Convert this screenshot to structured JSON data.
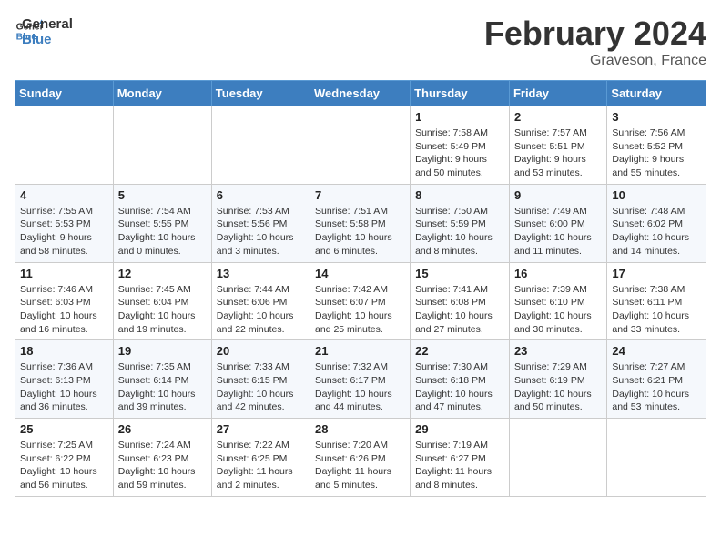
{
  "header": {
    "logo_line1": "General",
    "logo_line2": "Blue",
    "month": "February 2024",
    "location": "Graveson, France"
  },
  "weekdays": [
    "Sunday",
    "Monday",
    "Tuesday",
    "Wednesday",
    "Thursday",
    "Friday",
    "Saturday"
  ],
  "weeks": [
    [
      {
        "day": "",
        "info": ""
      },
      {
        "day": "",
        "info": ""
      },
      {
        "day": "",
        "info": ""
      },
      {
        "day": "",
        "info": ""
      },
      {
        "day": "1",
        "info": "Sunrise: 7:58 AM\nSunset: 5:49 PM\nDaylight: 9 hours\nand 50 minutes."
      },
      {
        "day": "2",
        "info": "Sunrise: 7:57 AM\nSunset: 5:51 PM\nDaylight: 9 hours\nand 53 minutes."
      },
      {
        "day": "3",
        "info": "Sunrise: 7:56 AM\nSunset: 5:52 PM\nDaylight: 9 hours\nand 55 minutes."
      }
    ],
    [
      {
        "day": "4",
        "info": "Sunrise: 7:55 AM\nSunset: 5:53 PM\nDaylight: 9 hours\nand 58 minutes."
      },
      {
        "day": "5",
        "info": "Sunrise: 7:54 AM\nSunset: 5:55 PM\nDaylight: 10 hours\nand 0 minutes."
      },
      {
        "day": "6",
        "info": "Sunrise: 7:53 AM\nSunset: 5:56 PM\nDaylight: 10 hours\nand 3 minutes."
      },
      {
        "day": "7",
        "info": "Sunrise: 7:51 AM\nSunset: 5:58 PM\nDaylight: 10 hours\nand 6 minutes."
      },
      {
        "day": "8",
        "info": "Sunrise: 7:50 AM\nSunset: 5:59 PM\nDaylight: 10 hours\nand 8 minutes."
      },
      {
        "day": "9",
        "info": "Sunrise: 7:49 AM\nSunset: 6:00 PM\nDaylight: 10 hours\nand 11 minutes."
      },
      {
        "day": "10",
        "info": "Sunrise: 7:48 AM\nSunset: 6:02 PM\nDaylight: 10 hours\nand 14 minutes."
      }
    ],
    [
      {
        "day": "11",
        "info": "Sunrise: 7:46 AM\nSunset: 6:03 PM\nDaylight: 10 hours\nand 16 minutes."
      },
      {
        "day": "12",
        "info": "Sunrise: 7:45 AM\nSunset: 6:04 PM\nDaylight: 10 hours\nand 19 minutes."
      },
      {
        "day": "13",
        "info": "Sunrise: 7:44 AM\nSunset: 6:06 PM\nDaylight: 10 hours\nand 22 minutes."
      },
      {
        "day": "14",
        "info": "Sunrise: 7:42 AM\nSunset: 6:07 PM\nDaylight: 10 hours\nand 25 minutes."
      },
      {
        "day": "15",
        "info": "Sunrise: 7:41 AM\nSunset: 6:08 PM\nDaylight: 10 hours\nand 27 minutes."
      },
      {
        "day": "16",
        "info": "Sunrise: 7:39 AM\nSunset: 6:10 PM\nDaylight: 10 hours\nand 30 minutes."
      },
      {
        "day": "17",
        "info": "Sunrise: 7:38 AM\nSunset: 6:11 PM\nDaylight: 10 hours\nand 33 minutes."
      }
    ],
    [
      {
        "day": "18",
        "info": "Sunrise: 7:36 AM\nSunset: 6:13 PM\nDaylight: 10 hours\nand 36 minutes."
      },
      {
        "day": "19",
        "info": "Sunrise: 7:35 AM\nSunset: 6:14 PM\nDaylight: 10 hours\nand 39 minutes."
      },
      {
        "day": "20",
        "info": "Sunrise: 7:33 AM\nSunset: 6:15 PM\nDaylight: 10 hours\nand 42 minutes."
      },
      {
        "day": "21",
        "info": "Sunrise: 7:32 AM\nSunset: 6:17 PM\nDaylight: 10 hours\nand 44 minutes."
      },
      {
        "day": "22",
        "info": "Sunrise: 7:30 AM\nSunset: 6:18 PM\nDaylight: 10 hours\nand 47 minutes."
      },
      {
        "day": "23",
        "info": "Sunrise: 7:29 AM\nSunset: 6:19 PM\nDaylight: 10 hours\nand 50 minutes."
      },
      {
        "day": "24",
        "info": "Sunrise: 7:27 AM\nSunset: 6:21 PM\nDaylight: 10 hours\nand 53 minutes."
      }
    ],
    [
      {
        "day": "25",
        "info": "Sunrise: 7:25 AM\nSunset: 6:22 PM\nDaylight: 10 hours\nand 56 minutes."
      },
      {
        "day": "26",
        "info": "Sunrise: 7:24 AM\nSunset: 6:23 PM\nDaylight: 10 hours\nand 59 minutes."
      },
      {
        "day": "27",
        "info": "Sunrise: 7:22 AM\nSunset: 6:25 PM\nDaylight: 11 hours\nand 2 minutes."
      },
      {
        "day": "28",
        "info": "Sunrise: 7:20 AM\nSunset: 6:26 PM\nDaylight: 11 hours\nand 5 minutes."
      },
      {
        "day": "29",
        "info": "Sunrise: 7:19 AM\nSunset: 6:27 PM\nDaylight: 11 hours\nand 8 minutes."
      },
      {
        "day": "",
        "info": ""
      },
      {
        "day": "",
        "info": ""
      }
    ]
  ]
}
